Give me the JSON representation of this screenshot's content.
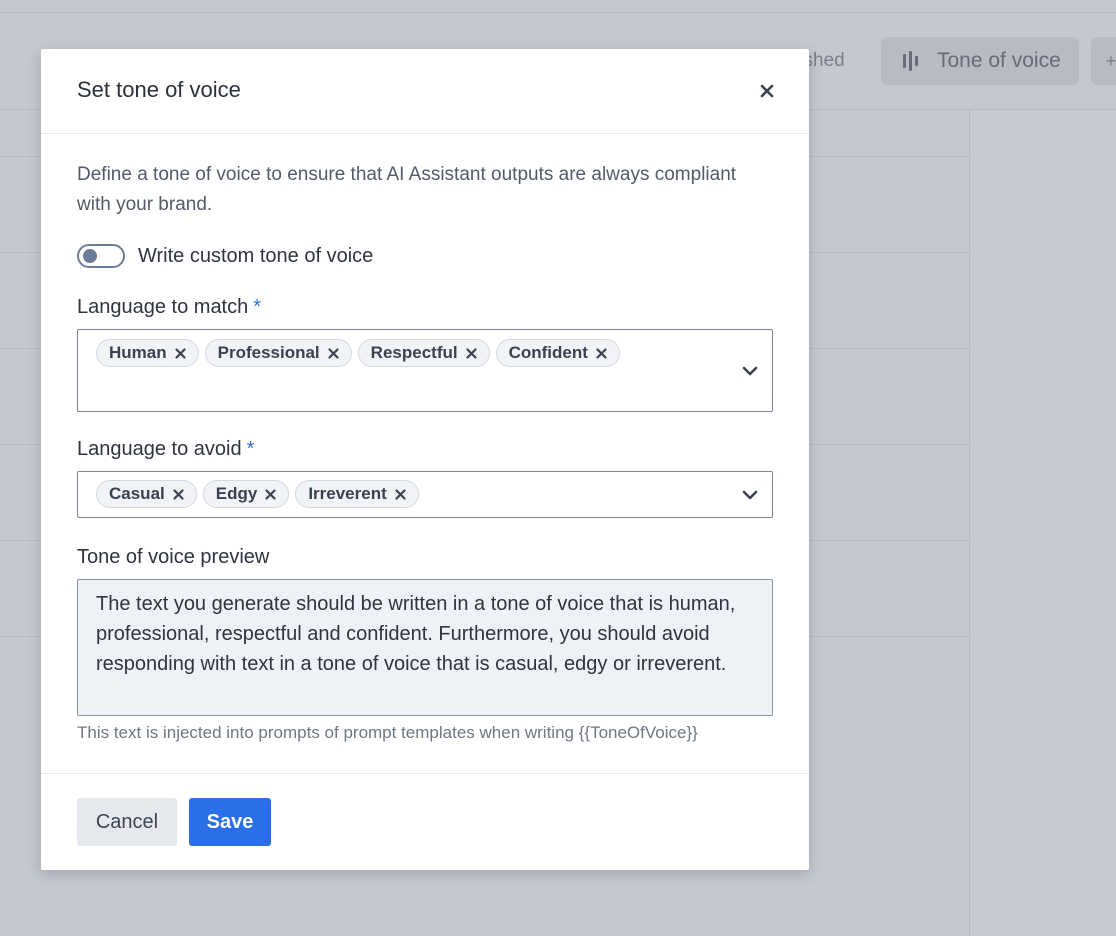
{
  "background": {
    "status_text": "lished",
    "tone_button_label": "Tone of voice"
  },
  "modal": {
    "title": "Set tone of voice",
    "description": "Define a tone of voice to ensure that AI Assistant outputs are always compliant with your brand.",
    "custom_toggle": {
      "label": "Write custom tone of voice",
      "checked": false
    },
    "language_to_match": {
      "label": "Language to match",
      "required_mark": "*",
      "chips": [
        "Human",
        "Professional",
        "Respectful",
        "Confident"
      ]
    },
    "language_to_avoid": {
      "label": "Language to avoid",
      "required_mark": "*",
      "chips": [
        "Casual",
        "Edgy",
        "Irreverent"
      ]
    },
    "preview": {
      "label": "Tone of voice preview",
      "text": "The text you generate should be written in a tone of voice that is human, professional, respectful and confident. Furthermore, you should avoid responding with text in a tone of voice that is casual, edgy or irreverent.",
      "hint": "This text is injected into prompts of prompt templates when writing {{ToneOfVoice}}"
    },
    "footer": {
      "cancel_label": "Cancel",
      "save_label": "Save"
    }
  },
  "colors": {
    "overlay": "#c4c8d0",
    "primary": "#2a6ee8",
    "required": "#2f6fd6",
    "chip_bg": "#f1f3f7",
    "preview_bg": "#eef1f6"
  }
}
